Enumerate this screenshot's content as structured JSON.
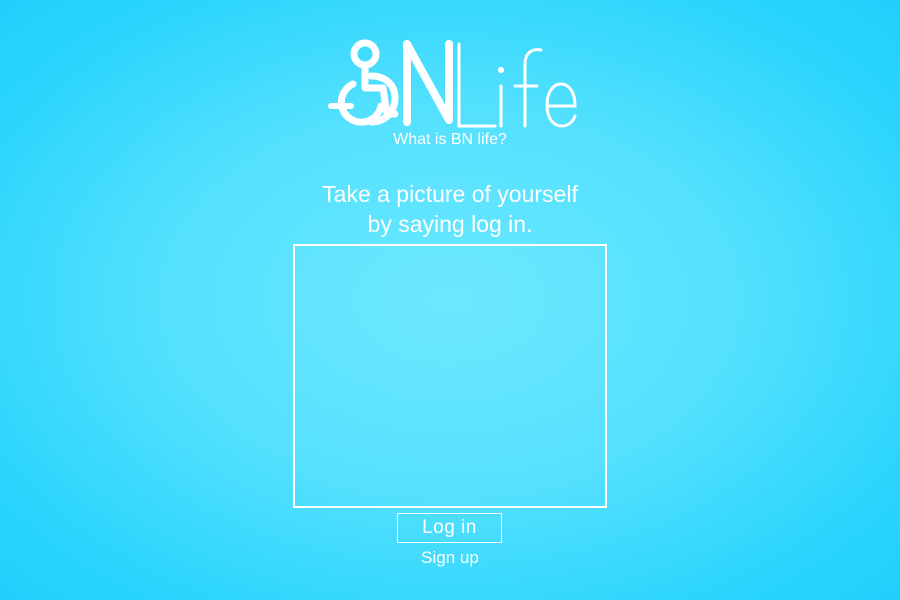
{
  "brand": {
    "logo_text": "BNLife",
    "logo_icon": "wheelchair-icon",
    "what_is_link": "What is BN life?"
  },
  "instructions": {
    "line1": "Take a picture of yourself",
    "line2": "by saying log in."
  },
  "camera": {
    "icon": "camera-frame"
  },
  "actions": {
    "login_label": "Log in",
    "signup_label": "Sign up"
  },
  "colors": {
    "background_center": "#6ae8ff",
    "background_edge": "#1fd0fb",
    "foreground": "#ffffff"
  }
}
